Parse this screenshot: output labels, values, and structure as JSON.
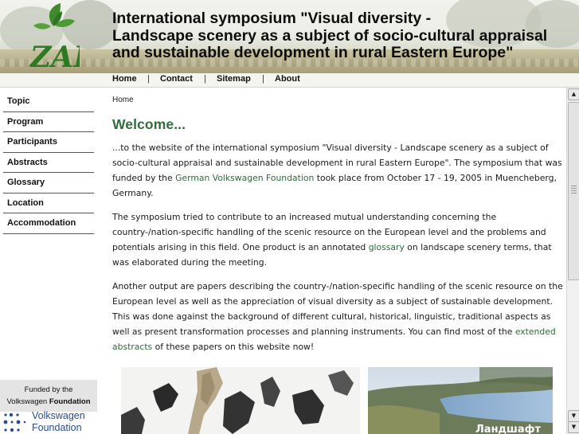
{
  "header": {
    "title_lines": [
      "International symposium \"Visual diversity -",
      "Landscape scenery as a subject of socio-cultural appraisal",
      "and sustainable development in rural Eastern Europe\""
    ],
    "logo_text": "ZALF"
  },
  "topnav": {
    "items": [
      "Home",
      "Contact",
      "Sitemap",
      "About"
    ],
    "separator": "|"
  },
  "sidebar": {
    "items": [
      "Topic",
      "Program",
      "Participants",
      "Abstracts",
      "Glossary",
      "Location",
      "Accommodation"
    ],
    "funded_line1": "Funded by the",
    "funded_line2_prefix": "Volkswagen ",
    "funded_line2_bold": "Foundation",
    "vw_logo_line1": "Volkswagen",
    "vw_logo_line2": "Foundation"
  },
  "main": {
    "breadcrumb": "Home",
    "heading": "Welcome...",
    "p1_a": "...to the website of the international symposium \"Visual diversity - Landscape scenery as a subject of socio-cultural appraisal and sustainable development in rural Eastern Europe\". The symposium that was funded by the ",
    "p1_link": "German Volkswagen Foundation",
    "p1_b": " took place from October 17 - 19, 2005 in Muencheberg, Germany.",
    "p2_a": "The symposium tried to contribute to an increased mutual understanding concerning the country-/nation-specific handling of the scenic resource on the European level and the problems and potentials arising in this field. One product is an annotated ",
    "p2_link": "glossary",
    "p2_b": " on landscape scenery terms, that was elaborated during the meeting.",
    "p3_a": "Another output are papers describing the country-/nation-specific handling of the scenic resource on the European level as well as the appreciation of visual diversity as a subject of sustainable development. This was done against the background of different cultural, historical, linguistic, traditional aspects as well as present transformation processes and planning instruments. You can find most of the ",
    "p3_link": "extended abstracts",
    "p3_b": " of these papers on this website now!",
    "image_caption": "Ландшафт"
  },
  "colors": {
    "heading_green": "#2f6e3c",
    "link_green": "#2e6b3d",
    "vw_blue": "#2a4d8c"
  }
}
